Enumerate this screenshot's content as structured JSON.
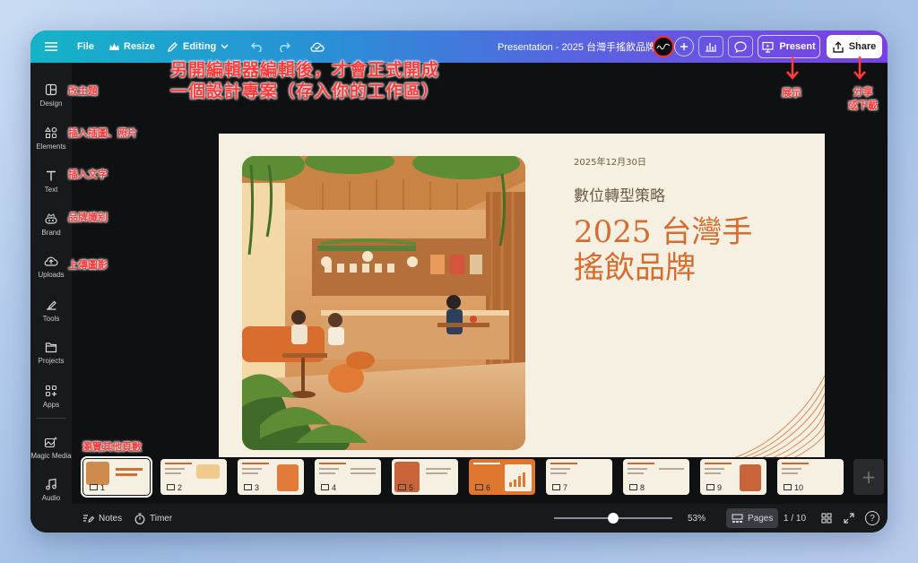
{
  "topbar": {
    "file_label": "File",
    "resize_label": "Resize",
    "editing_label": "Editing",
    "doc_title": "Presentation - 2025 台灣手搖飲品牌",
    "present_label": "Present",
    "share_label": "Share"
  },
  "sidebar": {
    "items": [
      {
        "label": "Design",
        "icon": "design-icon"
      },
      {
        "label": "Elements",
        "icon": "elements-icon"
      },
      {
        "label": "Text",
        "icon": "text-icon"
      },
      {
        "label": "Brand",
        "icon": "brand-icon"
      },
      {
        "label": "Uploads",
        "icon": "upload-icon"
      },
      {
        "label": "Tools",
        "icon": "tools-icon"
      },
      {
        "label": "Projects",
        "icon": "folder-icon"
      },
      {
        "label": "Apps",
        "icon": "apps-icon"
      },
      {
        "label": "Magic Media",
        "icon": "magic-media-icon"
      },
      {
        "label": "Audio",
        "icon": "audio-icon"
      }
    ]
  },
  "slide": {
    "date": "2025年12月30日",
    "subtitle": "數位轉型策略",
    "title_line1": "2025 台灣手",
    "title_line2": "搖飲品牌"
  },
  "pages": [
    {
      "num": "1"
    },
    {
      "num": "2"
    },
    {
      "num": "3"
    },
    {
      "num": "4"
    },
    {
      "num": "5"
    },
    {
      "num": "6"
    },
    {
      "num": "7"
    },
    {
      "num": "8"
    },
    {
      "num": "9"
    },
    {
      "num": "10"
    }
  ],
  "bottombar": {
    "notes_label": "Notes",
    "timer_label": "Timer",
    "zoom": "53%",
    "zoom_fraction": 0.5,
    "pages_label": "Pages",
    "page_counter": "1 / 10",
    "help_label": "?"
  },
  "annotations": {
    "editor_line1": "另開編輯器編輯後，才會正式開成",
    "editor_line2": "一個設計專案（存入你的工作區）",
    "design": "改主題",
    "elements": "插入插圖、照片",
    "text": "插入文字",
    "brand": "品牌識別",
    "uploads": "上傳圖影",
    "pages": "瀏覽其他頁數",
    "present": "展示",
    "share_line1": "分享",
    "share_line2": "或下載"
  },
  "colors": {
    "accent_red": "#ff3b3b",
    "slide_bg": "#f6f0e3",
    "title_orange": "#d56d2e",
    "toolbar_start": "#14b3c8",
    "toolbar_end": "#7b3fe4"
  }
}
